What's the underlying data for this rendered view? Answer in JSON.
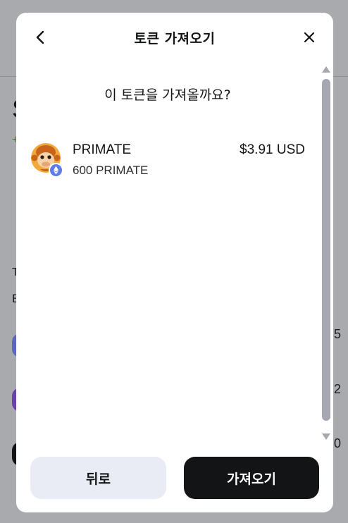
{
  "background": {
    "fragments": [
      "S",
      "+",
      "T",
      "E",
      "5",
      "2",
      "0"
    ]
  },
  "header": {
    "title": "토큰 가져오기"
  },
  "question": "이 토큰을 가져올까요?",
  "token": {
    "name": "PRIMATE",
    "amount": "600 PRIMATE",
    "value": "$3.91 USD",
    "network_badge_icon": "ethereum-icon"
  },
  "buttons": {
    "back_label": "뒤로",
    "import_label": "가져오기"
  },
  "colors": {
    "overlay": "#a9aaad",
    "primary_button": "#131416",
    "secondary_button": "#e9ecf4",
    "eth_badge": "#5d7ce8"
  }
}
